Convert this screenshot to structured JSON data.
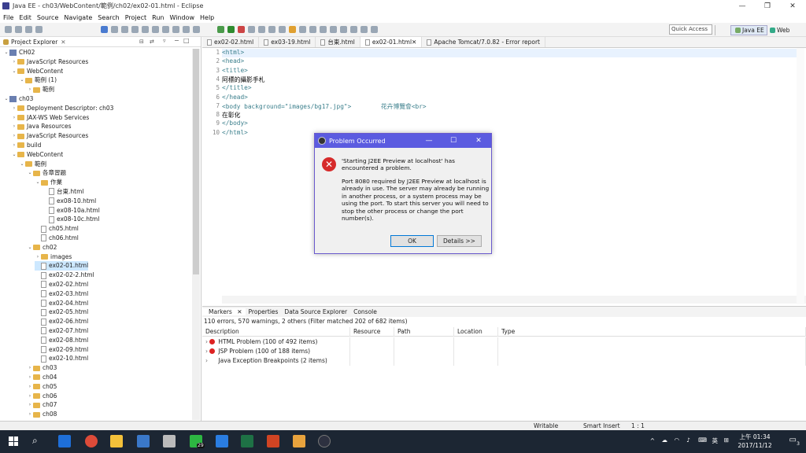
{
  "window": {
    "title": "Java EE - ch03/WebContent/範例/ch02/ex02-01.html - Eclipse"
  },
  "menu": [
    "File",
    "Edit",
    "Source",
    "Navigate",
    "Search",
    "Project",
    "Run",
    "Window",
    "Help"
  ],
  "toolbar": {
    "quick_access": "Quick Access",
    "perspective_javaee": "Java EE",
    "perspective_web": "Web"
  },
  "project_explorer": {
    "tab": "Project Explorer",
    "items": [
      {
        "label": "CH02",
        "level": 0,
        "type": "proj",
        "tw": "v"
      },
      {
        "label": "JavaScript Resources",
        "level": 1,
        "type": "fold",
        "tw": ">"
      },
      {
        "label": "WebContent",
        "level": 1,
        "type": "fold",
        "tw": "v"
      },
      {
        "label": "範例 (1)",
        "level": 2,
        "type": "fold",
        "tw": "v"
      },
      {
        "label": "範例",
        "level": 3,
        "type": "fold",
        "tw": ">"
      },
      {
        "label": "ch03",
        "level": 0,
        "type": "proj",
        "tw": "v"
      },
      {
        "label": "Deployment Descriptor: ch03",
        "level": 1,
        "type": "fold",
        "tw": ">"
      },
      {
        "label": "JAX-WS Web Services",
        "level": 1,
        "type": "fold",
        "tw": ">"
      },
      {
        "label": "Java Resources",
        "level": 1,
        "type": "fold",
        "tw": ">"
      },
      {
        "label": "JavaScript Resources",
        "level": 1,
        "type": "fold",
        "tw": ">"
      },
      {
        "label": "build",
        "level": 1,
        "type": "fold",
        "tw": ">"
      },
      {
        "label": "WebContent",
        "level": 1,
        "type": "fold",
        "tw": "v"
      },
      {
        "label": "範例",
        "level": 2,
        "type": "fold",
        "tw": "v"
      },
      {
        "label": "各章習題",
        "level": 3,
        "type": "fold",
        "tw": "v"
      },
      {
        "label": "作業",
        "level": 4,
        "type": "fold",
        "tw": "v"
      },
      {
        "label": "台東.html",
        "level": 5,
        "type": "file",
        "tw": ""
      },
      {
        "label": "ex08-10.html",
        "level": 5,
        "type": "file",
        "tw": ""
      },
      {
        "label": "ex08-10a.html",
        "level": 5,
        "type": "file",
        "tw": ""
      },
      {
        "label": "ex08-10c.html",
        "level": 5,
        "type": "file",
        "tw": ""
      },
      {
        "label": "ch05.html",
        "level": 4,
        "type": "file",
        "tw": ""
      },
      {
        "label": "ch06.html",
        "level": 4,
        "type": "file",
        "tw": ""
      },
      {
        "label": "ch02",
        "level": 3,
        "type": "fold",
        "tw": "v"
      },
      {
        "label": "images",
        "level": 4,
        "type": "fold",
        "tw": ">"
      },
      {
        "label": "ex02-01.html",
        "level": 4,
        "type": "file",
        "tw": "",
        "selected": true
      },
      {
        "label": "ex02-02-2.html",
        "level": 4,
        "type": "file",
        "tw": ""
      },
      {
        "label": "ex02-02.html",
        "level": 4,
        "type": "file",
        "tw": ""
      },
      {
        "label": "ex02-03.html",
        "level": 4,
        "type": "file",
        "tw": ""
      },
      {
        "label": "ex02-04.html",
        "level": 4,
        "type": "file",
        "tw": ""
      },
      {
        "label": "ex02-05.html",
        "level": 4,
        "type": "file",
        "tw": ""
      },
      {
        "label": "ex02-06.html",
        "level": 4,
        "type": "file",
        "tw": ""
      },
      {
        "label": "ex02-07.html",
        "level": 4,
        "type": "file",
        "tw": ""
      },
      {
        "label": "ex02-08.html",
        "level": 4,
        "type": "file",
        "tw": ""
      },
      {
        "label": "ex02-09.html",
        "level": 4,
        "type": "file",
        "tw": ""
      },
      {
        "label": "ex02-10.html",
        "level": 4,
        "type": "file",
        "tw": ""
      },
      {
        "label": "ch03",
        "level": 3,
        "type": "fold",
        "tw": ">"
      },
      {
        "label": "ch04",
        "level": 3,
        "type": "fold",
        "tw": ">"
      },
      {
        "label": "ch05",
        "level": 3,
        "type": "fold",
        "tw": ">"
      },
      {
        "label": "ch06",
        "level": 3,
        "type": "fold",
        "tw": ">"
      },
      {
        "label": "ch07",
        "level": 3,
        "type": "fold",
        "tw": ">"
      },
      {
        "label": "ch08",
        "level": 3,
        "type": "fold",
        "tw": ">"
      }
    ]
  },
  "editor_tabs": [
    {
      "label": "ex02-02.html",
      "active": false
    },
    {
      "label": "ex03-19.html",
      "active": false
    },
    {
      "label": "台東.html",
      "active": false
    },
    {
      "label": "ex02-01.html",
      "active": true
    },
    {
      "label": "Apache Tomcat/7.0.82 - Error report",
      "active": false
    }
  ],
  "editor_lines": [
    {
      "n": "1",
      "t": "<html>"
    },
    {
      "n": "2",
      "t": "<head>"
    },
    {
      "n": "3",
      "t": "<title>"
    },
    {
      "n": "4",
      "t": "阿標的攝影手札"
    },
    {
      "n": "5",
      "t": "</title>"
    },
    {
      "n": "6",
      "t": "</head>"
    },
    {
      "n": "7",
      "t": "<body background=\"images/bg17.jpg\">        花卉博覽會<br>"
    },
    {
      "n": "8",
      "t": "在彰化"
    },
    {
      "n": "9",
      "t": "</body>"
    },
    {
      "n": "10",
      "t": "</html>"
    }
  ],
  "bottom_tabs": [
    "Markers",
    "Properties",
    "Data Source Explorer",
    "Console"
  ],
  "markers": {
    "summary": "110 errors, 570 warnings, 2 others (Filter matched 202 of 682 items)",
    "columns": [
      "Description",
      "Resource",
      "Path",
      "Location",
      "Type"
    ],
    "rows": [
      {
        "label": "HTML Problem (100 of 492 items)",
        "error": true
      },
      {
        "label": "JSP Problem (100 of 188 items)",
        "error": true
      },
      {
        "label": "Java Exception Breakpoints (2 items)",
        "error": false
      }
    ]
  },
  "status": {
    "writable": "Writable",
    "insert": "Smart Insert",
    "pos": "1 : 1"
  },
  "dialog": {
    "title": "Problem Occurred",
    "message1": "'Starting J2EE Preview at localhost' has encountered a problem.",
    "message2": "Port 8080 required by J2EE Preview at localhost is already in use. The server may already be running in another process, or a system process may be using the port. To start this server you will need to stop the other process or change the port number(s).",
    "ok": "OK",
    "details": "Details >>"
  },
  "taskbar": {
    "time": "上午 01:34",
    "date": "2017/11/12",
    "lang": "英",
    "badge_line": "29",
    "notif": "3"
  }
}
